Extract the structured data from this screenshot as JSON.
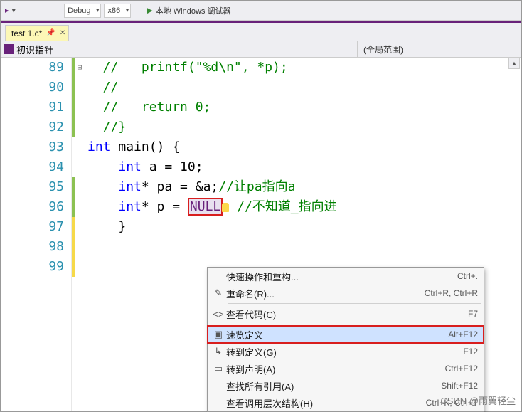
{
  "toolbar": {
    "configuration": "Debug",
    "platform": "x86",
    "run_label": "本地 Windows 调试器"
  },
  "tab": {
    "filename": "test 1.c*"
  },
  "nav": {
    "left_label": "初识指针",
    "right_label": "(全局范围)"
  },
  "code_lines": [
    {
      "n": 89,
      "mark": "g",
      "text": "  //   printf(\"%d\\n\", *p);",
      "cls": "c-comment"
    },
    {
      "n": 90,
      "mark": "g",
      "text": "  //",
      "cls": "c-comment"
    },
    {
      "n": 91,
      "mark": "g",
      "text": "  //   return 0;",
      "cls": "c-comment"
    },
    {
      "n": 92,
      "mark": "g",
      "text": "  //}",
      "cls": "c-comment"
    },
    {
      "n": 93,
      "mark": "",
      "text": "",
      "cls": ""
    },
    {
      "n": 94,
      "mark": "",
      "text": "",
      "cls": ""
    },
    {
      "n": 95,
      "mark": "g",
      "fold": "⊟",
      "html": true,
      "text": "<span class='c-keyword'>int</span> main() {"
    },
    {
      "n": 96,
      "mark": "g",
      "html": true,
      "text": "    <span class='c-keyword'>int</span> a = 10;"
    },
    {
      "n": 97,
      "mark": "y",
      "html": true,
      "text": "    <span class='c-keyword'>int</span>* pa = &amp;a;<span class='c-comment'>//让pa指向a</span>"
    },
    {
      "n": 98,
      "mark": "y",
      "html": true,
      "text": "    <span class='c-keyword'>int</span>* p = <span class='c-null'>NULL</span><span class='bulb'></span><span class='c-comment'> //不知道_指向进</span>"
    },
    {
      "n": 99,
      "mark": "y",
      "text": "    }",
      "cls": ""
    }
  ],
  "menu": [
    {
      "icon": "",
      "label": "快速操作和重构...",
      "shortcut": "Ctrl+."
    },
    {
      "icon": "✎",
      "label": "重命名(R)...",
      "shortcut": "Ctrl+R, Ctrl+R"
    },
    {
      "sep": true
    },
    {
      "icon": "<>",
      "label": "查看代码(C)",
      "shortcut": "F7"
    },
    {
      "sep": true
    },
    {
      "icon": "▣",
      "label": "速览定义",
      "shortcut": "Alt+F12",
      "highlight": true
    },
    {
      "icon": "↳",
      "label": "转到定义(G)",
      "shortcut": "F12"
    },
    {
      "icon": "▭",
      "label": "转到声明(A)",
      "shortcut": "Ctrl+F12"
    },
    {
      "icon": "",
      "label": "查找所有引用(A)",
      "shortcut": "Shift+F12"
    },
    {
      "icon": "",
      "label": "查看调用层次结构(H)",
      "shortcut": "Ctrl+K, Ctrl+T"
    }
  ],
  "watermark": "CSDN @雨翼轻尘"
}
